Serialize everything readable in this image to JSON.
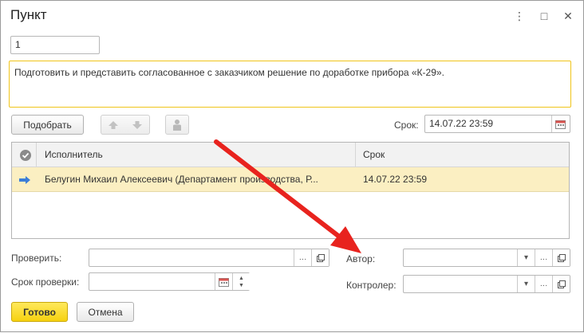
{
  "window": {
    "title": "Пункт",
    "menu_glyph": "⋮",
    "maximize_glyph": "□",
    "close_glyph": "✕"
  },
  "form": {
    "number_value": "1",
    "description_value": "Подготовить и представить согласованное с заказчиком решение по доработке прибора «К-29».",
    "pick_button": "Подобрать",
    "deadline_label": "Срок:",
    "deadline_value": "14.07.22 23:59"
  },
  "table": {
    "columns": [
      "Исполнитель",
      "Срок"
    ],
    "rows": [
      {
        "executor": "Белугин Михаил Алексеевич (Департамент производства, Р...",
        "deadline": "14.07.22 23:59"
      }
    ]
  },
  "fields": {
    "check_label": "Проверить:",
    "check_value": "",
    "check_deadline_label": "Срок проверки:",
    "check_deadline_value": "",
    "author_label": "Автор:",
    "author_value": "",
    "controller_label": "Контролер:",
    "controller_value": ""
  },
  "footer": {
    "ok_button": "Готово",
    "cancel_button": "Отмена"
  },
  "colors": {
    "accent_yellow": "#f6d10f",
    "selected_row": "#fbefc2",
    "annotation_arrow": "#e8231e",
    "focus_border": "#f0c419"
  }
}
